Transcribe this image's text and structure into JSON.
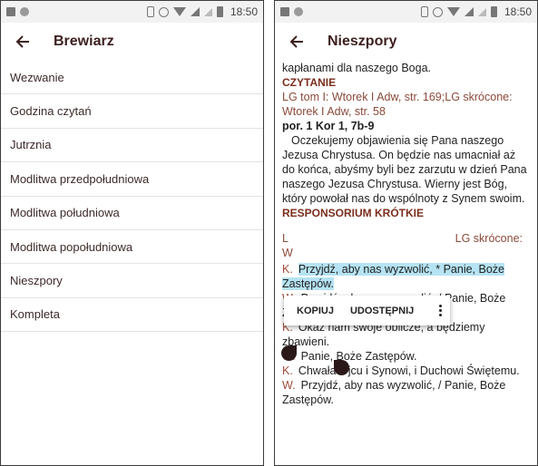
{
  "status_bar": {
    "time": "18:50"
  },
  "left_screen": {
    "title": "Brewiarz",
    "items": [
      "Wezwanie",
      "Godzina czytań",
      "Jutrznia",
      "Modlitwa przedpołudniowa",
      "Modlitwa południowa",
      "Modlitwa popołudniowa",
      "Nieszpory",
      "Kompleta"
    ]
  },
  "right_screen": {
    "title": "Nieszpory",
    "line1": "kapłanami dla naszego Boga.",
    "section1": "CZYTANIE",
    "ref1": "LG tom I: Wtorek I Adw, str. 169;LG skrócone: Wtorek I Adw, str. 58",
    "reading_ref": "por. 1 Kor 1, 7b-9",
    "reading": "Oczekujemy objawienia się Pana naszego Jezusa Chrystusa. On będzie nas umacniał aż do końca, abyśmy byli bez zarzutu w dzień Pana naszego Jezusa Chrystusa. Wierny jest Bóg, który powołał nas do wspólnoty z Synem swoim.",
    "section2": "RESPONSORIUM KRÓTKIE",
    "ref2_left": "L",
    "ref2_right": "LG skrócone:",
    "ref2_line2": "W",
    "responsory": [
      {
        "mark": "K.",
        "text": "Przyjdź, aby nas wyzwolić, * Panie, Boże Zastępów."
      },
      {
        "mark": "W.",
        "text": "Przyjdź, aby nas wyzwolić, / Panie, Boże Zastępów."
      },
      {
        "mark": "K.",
        "text": "Okaż nam swoje oblicze, a będziemy zbawieni."
      },
      {
        "mark": "W.",
        "text": "Panie, Boże Zastępów."
      },
      {
        "mark": "K.",
        "text": "Chwała Ojcu i Synowi, i Duchowi Świętemu."
      },
      {
        "mark": "W.",
        "text": "Przyjdź, aby nas wyzwolić, / Panie, Boże Zastępów."
      }
    ],
    "context_menu": {
      "copy": "KOPIUJ",
      "share": "UDOSTĘPNIJ"
    }
  }
}
